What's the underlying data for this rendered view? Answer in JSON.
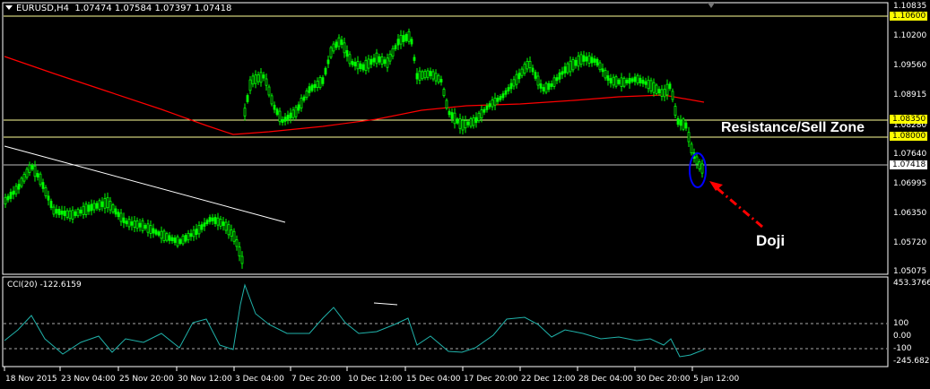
{
  "header": {
    "symbol": "EURUSD,H4",
    "ohlc": "1.07474 1.07584 1.07397 1.07418"
  },
  "price_axis": [
    "1.10835",
    "1.10200",
    "1.09560",
    "1.08915",
    "1.08280",
    "1.07640",
    "1.06995",
    "1.06350",
    "1.05720",
    "1.05075"
  ],
  "price_highlights": [
    {
      "label": "1.10600",
      "bg": "#ffff00",
      "fg": "#000000"
    },
    {
      "label": "1.08350",
      "bg": "#ffff00",
      "fg": "#000000"
    },
    {
      "label": "1.08000",
      "bg": "#ffff00",
      "fg": "#000000"
    },
    {
      "label": "1.07418",
      "bg": "#ffffff",
      "fg": "#000000"
    }
  ],
  "time_axis": [
    "18 Nov 2015",
    "23 Nov 04:00",
    "25 Nov 20:00",
    "30 Nov 12:00",
    "3 Dec 04:00",
    "7 Dec 20:00",
    "10 Dec 12:00",
    "15 Dec 04:00",
    "17 Dec 20:00",
    "22 Dec 12:00",
    "28 Dec 04:00",
    "30 Dec 20:00",
    "5 Jan 12:00"
  ],
  "indicator": {
    "label": "CCI(20) -122.6159",
    "axis": [
      "453.3766",
      "100",
      "0.00",
      "-100",
      "-245.6828"
    ]
  },
  "annotations": {
    "zone": "Resistance/Sell Zone",
    "doji": "Doji"
  },
  "colors": {
    "candles": "#00ff00",
    "moving_average": "#ff0000",
    "levels": "#ffff99",
    "cci": "#20b2aa",
    "trendline": "#ffffff",
    "marker": "#0000ff",
    "arrow": "#ff0000"
  }
}
